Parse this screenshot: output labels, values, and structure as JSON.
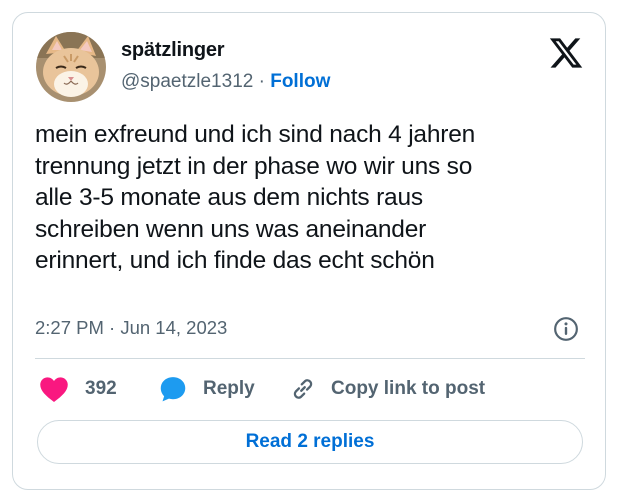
{
  "author": {
    "display_name": "spätzlinger",
    "handle": "@spaetzle1312",
    "separator": "·",
    "follow_label": "Follow",
    "avatar_icon": "cat-avatar"
  },
  "platform_icon": "x-logo-icon",
  "tweet": {
    "lines": [
      "mein exfreund und ich sind nach 4 jahren",
      "trennung jetzt in der phase wo wir uns so",
      "alle 3-5 monate aus dem nichts raus",
      "schreiben wenn uns was aneinander",
      "erinnert, und ich finde das echt schön"
    ],
    "timestamp": "2:27 PM · Jun 14, 2023"
  },
  "actions": {
    "likes_count": "392",
    "reply_label": "Reply",
    "copy_label": "Copy link to post"
  },
  "read_replies_label": "Read 2 replies",
  "colors": {
    "like": "#f91880",
    "reply": "#1d9bf0",
    "link": "#006fd6",
    "muted": "#536471",
    "border": "#cfd9de"
  }
}
